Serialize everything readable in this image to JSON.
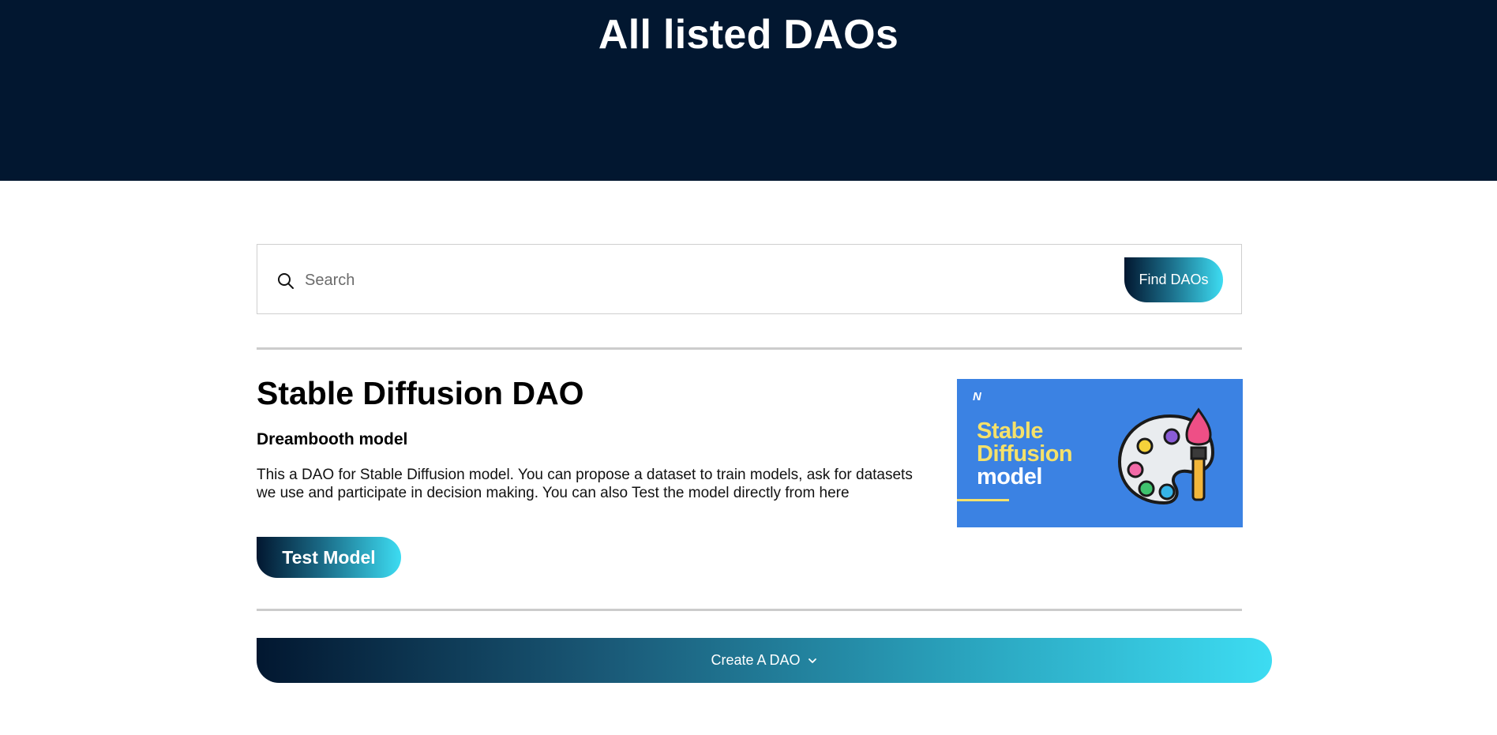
{
  "header": {
    "title": "All listed DAOs"
  },
  "search": {
    "placeholder": "Search",
    "value": "",
    "button_label": "Find DAOs"
  },
  "dao": {
    "title": "Stable Diffusion DAO",
    "subtitle": "Dreambooth model",
    "description": "This a DAO for Stable Diffusion model. You can propose a dataset to train models, ask for datasets we use and participate in decision making. You can also Test the model directly from here",
    "test_button_label": "Test Model",
    "image": {
      "logo": "N",
      "line1": "Stable",
      "line2": "Diffusion",
      "line3": "model",
      "background_color": "#3b82e3",
      "accent_color": "#f5e16a"
    }
  },
  "footer": {
    "create_button_label": "Create A DAO"
  },
  "colors": {
    "header_bg": "#021730",
    "gradient_start": "#021730",
    "gradient_end": "#3ddcf2"
  }
}
